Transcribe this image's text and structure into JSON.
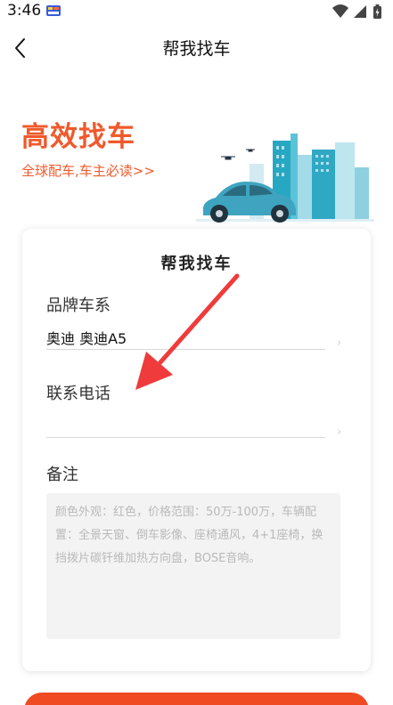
{
  "status_bar": {
    "time": "3:46",
    "icons": [
      "app-badge-icon",
      "wifi-icon",
      "signal-icon",
      "battery-icon"
    ]
  },
  "nav": {
    "title": "帮我找车",
    "back_icon": "back-arrow-icon"
  },
  "hero": {
    "title": "高效找车",
    "subtitle_link": "全球配车,车主必读>>",
    "illustration": "car-city-illustration"
  },
  "form": {
    "title": "帮我找车",
    "brand": {
      "label": "品牌车系",
      "value": "奥迪 奥迪A5"
    },
    "phone": {
      "label": "联系电话",
      "value": ""
    },
    "remark": {
      "label": "备注",
      "placeholder": "颜色外观：红色，价格范围：50万-100万，车辆配置：全景天窗、倒车影像、座椅通风，4+1座椅，换挡拨片碳钎维加热方向盘，BOSE音响。"
    }
  },
  "colors": {
    "accent": "#ef5a2c",
    "button": "#ef4a22",
    "annotation_arrow": "#ef3b3b"
  }
}
